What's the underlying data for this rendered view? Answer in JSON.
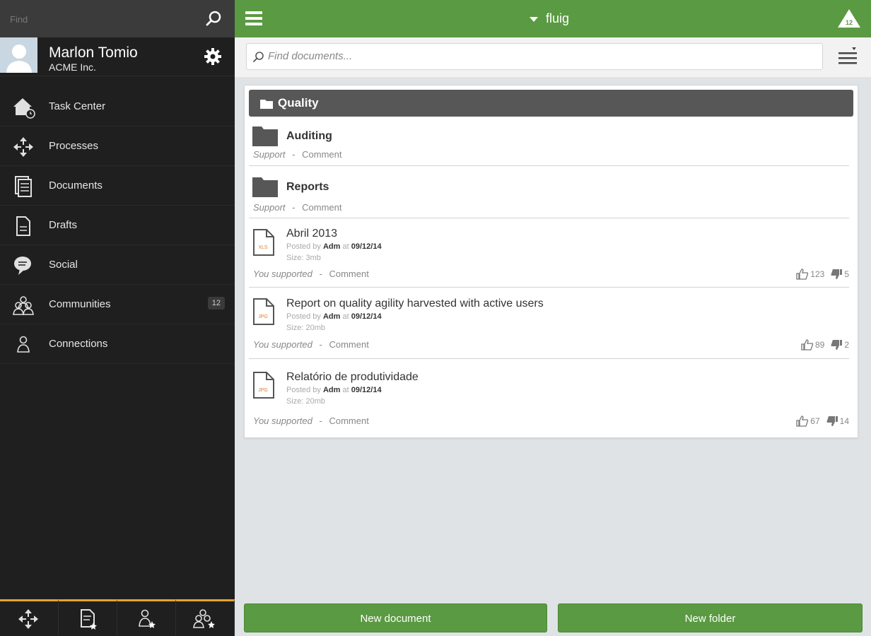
{
  "sidebar": {
    "search_placeholder": "Find",
    "user": {
      "name": "Marlon Tomio",
      "org": "ACME Inc."
    },
    "items": [
      {
        "label": "Task Center",
        "icon": "house-clock-icon"
      },
      {
        "label": "Processes",
        "icon": "processes-icon"
      },
      {
        "label": "Documents",
        "icon": "documents-icon"
      },
      {
        "label": "Drafts",
        "icon": "draft-icon"
      },
      {
        "label": "Social",
        "icon": "chat-bubble-icon"
      },
      {
        "label": "Communities",
        "icon": "communities-icon",
        "badge": "12"
      },
      {
        "label": "Connections",
        "icon": "connections-icon"
      }
    ]
  },
  "topbar": {
    "brand": "fluig",
    "notifications": "12"
  },
  "search": {
    "placeholder": "Find documents..."
  },
  "folder": {
    "title": "Quality",
    "rows": [
      {
        "title": "Auditing",
        "support": "Support",
        "sep": "-",
        "comment": "Comment"
      },
      {
        "title": "Reports",
        "support": "Support",
        "sep": "-",
        "comment": "Comment"
      }
    ],
    "files": [
      {
        "title": "Abril 2013",
        "type": "XLS",
        "posted_by": "Posted by",
        "author": "Adm",
        "at": "at",
        "date": "09/12/14",
        "size": "Size: 3mb",
        "supported": "You supported",
        "sep": "-",
        "comment": "Comment",
        "likes": "123",
        "dislikes": "5"
      },
      {
        "title": "Report on quality agility harvested with active users",
        "type": "JPG",
        "posted_by": "Posted by",
        "author": "Adm",
        "at": "at",
        "date": "09/12/14",
        "size": "Size: 20mb",
        "supported": "You supported",
        "sep": "-",
        "comment": "Comment",
        "likes": "89",
        "dislikes": "2"
      },
      {
        "title": "Relatório de produtividade",
        "type": "JPG",
        "posted_by": "Posted by",
        "author": "Adm",
        "at": "at",
        "date": "09/12/14",
        "size": "Size: 20mb",
        "supported": "You supported",
        "sep": "-",
        "comment": "Comment",
        "likes": "67",
        "dislikes": "14"
      }
    ]
  },
  "buttons": {
    "new_document": "New document",
    "new_folder": "New folder"
  },
  "colors": {
    "accent": "#5a9a42",
    "sidebar": "#1f1f1f",
    "bottom_accent": "#e4a52a"
  }
}
